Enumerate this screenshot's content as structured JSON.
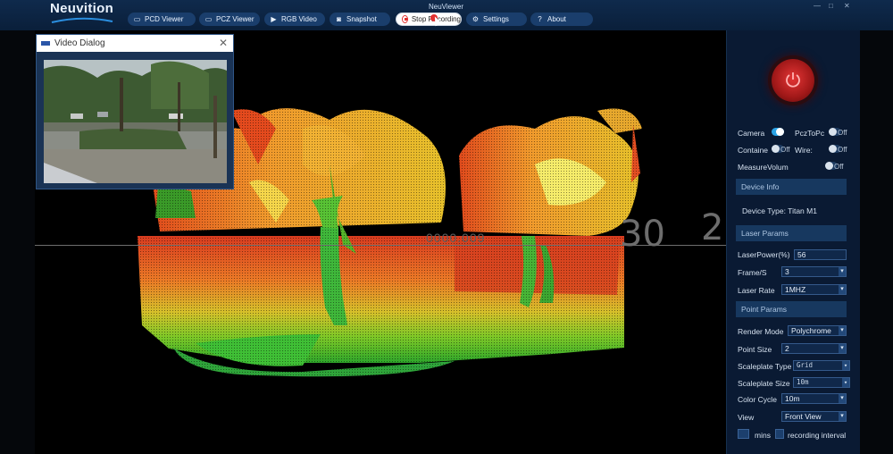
{
  "app": {
    "logo_text": "Neuvition",
    "title": "NeuViewer",
    "window_controls": [
      "—",
      "□",
      "✕"
    ]
  },
  "nav": [
    {
      "label": "PCD Viewer",
      "icon": "folder-icon"
    },
    {
      "label": "PCZ Viewer",
      "icon": "folder-icon"
    },
    {
      "label": "RGB Video",
      "icon": "video-icon"
    },
    {
      "label": "Snapshot",
      "icon": "camera-icon"
    },
    {
      "label": "Stop Recording",
      "icon": "stop-record-icon"
    },
    {
      "label": "Settings",
      "icon": "gear-icon"
    },
    {
      "label": "About",
      "icon": "help-icon"
    }
  ],
  "viewport": {
    "scale_numbers": [
      "30",
      "2"
    ],
    "scale_small": "0000.009"
  },
  "video_dialog": {
    "title": "Video Dialog",
    "close": "✕"
  },
  "panel": {
    "camera": {
      "label": "Camera",
      "state": "on"
    },
    "pcz_to_pc": {
      "label": "PczToPc",
      "state_text": "Off"
    },
    "container": {
      "label": "Containe",
      "state_text": "Off"
    },
    "wire": {
      "label": "Wire:",
      "state_text": "Off"
    },
    "measure_volume": {
      "label": "MeasureVolum",
      "state_text": "Off"
    },
    "device_info": {
      "header": "Device Info",
      "device_type": "Device Type: Titan M1"
    },
    "laser_params": {
      "header": "Laser Params",
      "laser_power_label": "LaserPower(%)",
      "laser_power_value": "56",
      "frame_label": "Frame/S",
      "frame_value": "3",
      "laser_rate_label": "Laser Rate",
      "laser_rate_value": "1MHZ"
    },
    "point_params": {
      "header": "Point Params",
      "render_mode_label": "Render Mode",
      "render_mode_value": "Polychrome",
      "point_size_label": "Point Size",
      "point_size_value": "2",
      "scaleplate_type_label": "Scaleplate Type",
      "scaleplate_type_value": "Grid",
      "scaleplate_size_label": "Scaleplate Size",
      "scaleplate_size_value": "10m",
      "color_cycle_label": "Color Cycle",
      "color_cycle_value": "10m",
      "view_label": "View",
      "view_value": "Front View",
      "mins_label": "mins",
      "recording_interval_label": "recording interval"
    }
  },
  "colors": {
    "accent": "#2aa3e6",
    "power": "#d62c2c",
    "panel_bg": "#0a1a33"
  }
}
